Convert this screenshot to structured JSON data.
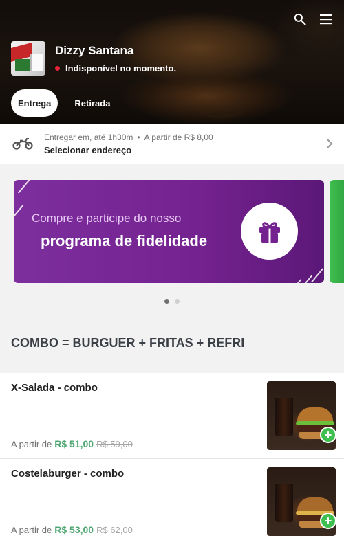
{
  "store": {
    "name": "Dizzy Santana",
    "status": "Indisponível no momento."
  },
  "tabs": [
    {
      "label": "Entrega",
      "active": true
    },
    {
      "label": "Retirada",
      "active": false
    }
  ],
  "delivery": {
    "time_label": "Entregar em, até 1h30m",
    "min_order": "A partir de R$ 8,00",
    "address_action": "Selecionar endereço"
  },
  "banner": {
    "line1": "Compre e participe do nosso",
    "line2": "programa de fidelidade",
    "page_count": 2,
    "active_page": 1
  },
  "section": {
    "title": "COMBO = BURGUER + FRITAS + REFRI"
  },
  "items": [
    {
      "name": "X-Salada - combo",
      "from_label": "A partir de",
      "price": "R$ 51,00",
      "old_price": "R$ 59,00"
    },
    {
      "name": "Costelaburger - combo",
      "from_label": "A partir de",
      "price": "R$ 53,00",
      "old_price": "R$ 62,00"
    }
  ],
  "colors": {
    "accent_green": "#50a773",
    "status_red": "#e7243a",
    "banner_purple": "#74228f"
  },
  "icons": {
    "search": "search-icon",
    "menu": "menu-icon",
    "delivery": "motorcycle-icon",
    "chevron": "chevron-right-icon",
    "gift": "gift-icon",
    "add": "plus-icon"
  }
}
